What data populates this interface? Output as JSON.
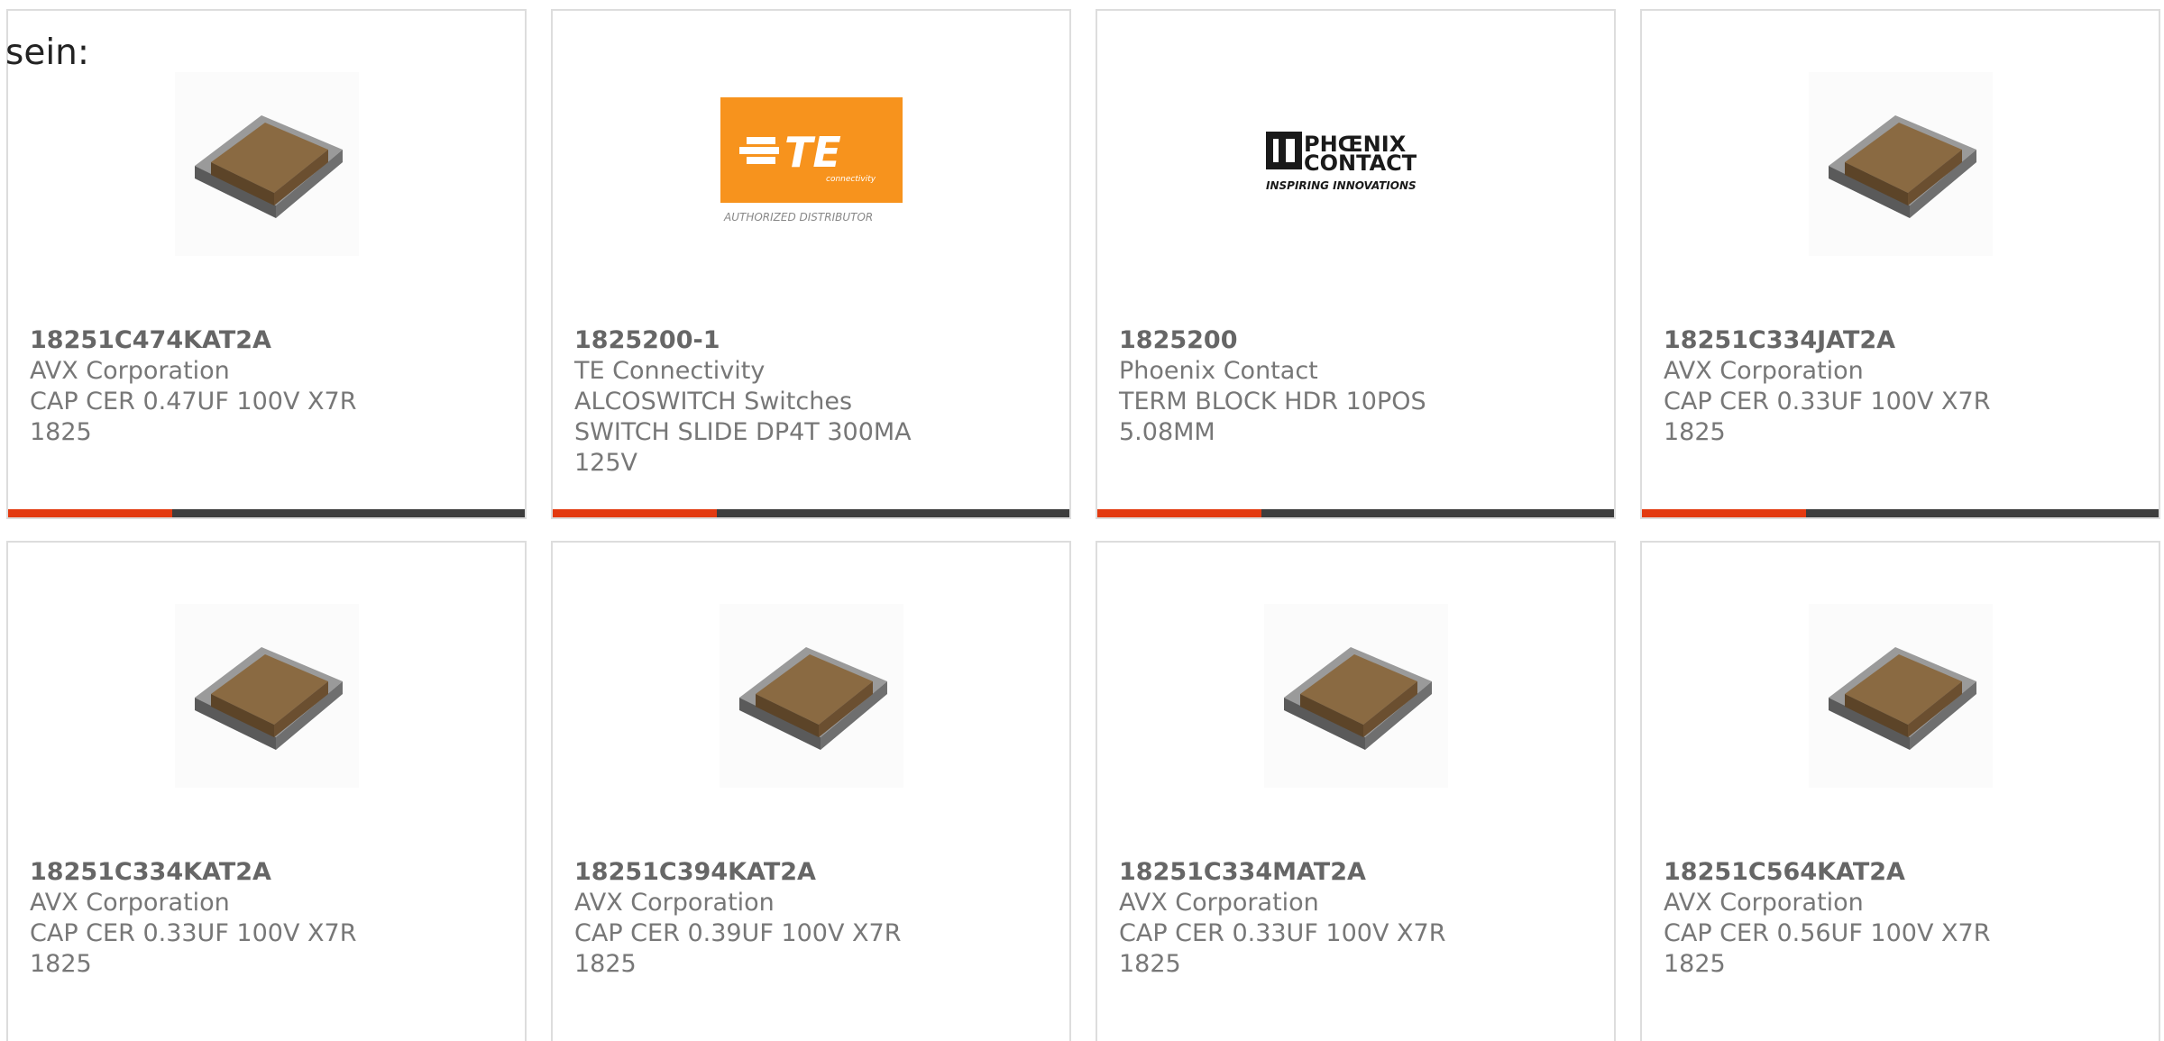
{
  "intro_text": "sein:",
  "colors": {
    "accent": "#e33a10",
    "bar": "#3d3d3d",
    "te_orange": "#f7931d",
    "chip_body": "#8a6a42",
    "chip_terminal": "#8e8e8e"
  },
  "products": [
    {
      "part_number": "18251C474KAT2A",
      "manufacturer": "AVX Corporation",
      "description": "CAP CER 0.47UF 100V X7R 1825",
      "image": "ceramic-capacitor-chip"
    },
    {
      "part_number": "1825200-1",
      "manufacturer": "TE Connectivity ALCOSWITCH Switches",
      "description": "SWITCH SLIDE DP4T 300MA 125V",
      "image": "te-connectivity-logo",
      "logo": {
        "mark": "TE",
        "sub": "connectivity",
        "caption": "AUTHORIZED DISTRIBUTOR"
      }
    },
    {
      "part_number": "1825200",
      "manufacturer": "Phoenix Contact",
      "description": "TERM BLOCK HDR 10POS 5.08MM",
      "image": "phoenix-contact-logo",
      "logo": {
        "line1": "PHŒNIX",
        "line2": "CONTACT",
        "tagline": "INSPIRING INNOVATIONS"
      }
    },
    {
      "part_number": "18251C334JAT2A",
      "manufacturer": "AVX Corporation",
      "description": "CAP CER 0.33UF 100V X7R 1825",
      "image": "ceramic-capacitor-chip"
    },
    {
      "part_number": "18251C334KAT2A",
      "manufacturer": "AVX Corporation",
      "description": "CAP CER 0.33UF 100V X7R 1825",
      "image": "ceramic-capacitor-chip"
    },
    {
      "part_number": "18251C394KAT2A",
      "manufacturer": "AVX Corporation",
      "description": "CAP CER 0.39UF 100V X7R 1825",
      "image": "ceramic-capacitor-chip"
    },
    {
      "part_number": "18251C334MAT2A",
      "manufacturer": "AVX Corporation",
      "description": "CAP CER 0.33UF 100V X7R 1825",
      "image": "ceramic-capacitor-chip"
    },
    {
      "part_number": "18251C564KAT2A",
      "manufacturer": "AVX Corporation",
      "description": "CAP CER 0.56UF 100V X7R 1825",
      "image": "ceramic-capacitor-chip"
    }
  ]
}
